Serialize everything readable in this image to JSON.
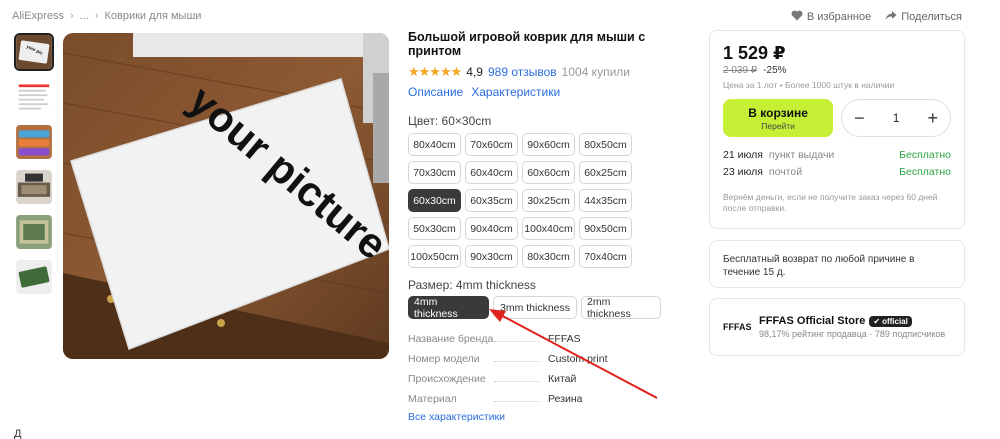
{
  "breadcrumb": {
    "root": "AliExpress",
    "ellipsis": "...",
    "category": "Коврики для мыши"
  },
  "top_actions": {
    "favorite": "В избранное",
    "share": "Поделиться"
  },
  "product": {
    "title": "Большой игровой коврик для мыши с принтом",
    "rating": "4,9",
    "reviews": "989 отзывов",
    "sold": "1004 купили",
    "link_description": "Описание",
    "link_specs": "Характеристики",
    "image_text": "your picture"
  },
  "color_option": {
    "label": "Цвет: 60×30cm",
    "sizes": [
      "80x40cm",
      "70x60cm",
      "90x60cm",
      "80x50cm",
      "70x30cm",
      "60x40cm",
      "60x60cm",
      "60x25cm",
      "60x30cm",
      "60x35cm",
      "30x25cm",
      "44x35cm",
      "50x30cm",
      "90x40cm",
      "100x40cm",
      "90x50cm",
      "100x50cm",
      "90x30cm",
      "80x30cm",
      "70x40cm"
    ],
    "selected": "60x30cm"
  },
  "thickness_option": {
    "label": "Размер: 4mm thickness",
    "values": [
      "4mm thickness",
      "3mm thickness",
      "2mm thickness"
    ],
    "selected": "4mm thickness"
  },
  "specs": [
    {
      "k": "Название бренда",
      "v": "FFFAS"
    },
    {
      "k": "Номер модели",
      "v": "Custom print"
    },
    {
      "k": "Происхождение",
      "v": "Китай"
    },
    {
      "k": "Материал",
      "v": "Резина"
    }
  ],
  "all_specs": "Все характеристики",
  "buy_box": {
    "price": "1 529 ₽",
    "old_price": "2 039 ₽",
    "discount": "-25%",
    "note": "Цена за 1 лот • Более 1000 штук в наличии",
    "cart_label": "В корзине",
    "cart_sub": "Перейти",
    "qty": "1",
    "qty_minus": "−",
    "qty_plus": "+",
    "delivery": [
      {
        "date": "21 июля",
        "method": "пункт выдачи",
        "price": "Бесплатно"
      },
      {
        "date": "23 июля",
        "method": "почтой",
        "price": "Бесплатно"
      }
    ],
    "refund": "Вернём деньги, если не получите заказ через 60 дней после отправки."
  },
  "return_box": {
    "text": "Бесплатный возврат по любой причине в течение 15 д."
  },
  "store": {
    "logo": "FFFAS",
    "name": "FFFAS Official Store",
    "badge": "official",
    "sub": "98,17% рейтинг продавца · 789 подписчиков"
  },
  "bottom": {
    "glyph": "Д"
  },
  "colors": {
    "accent": "#c6f036",
    "link": "#2a6de0",
    "free": "#2aa444",
    "arrow": "#e0221c",
    "star": "#f5a623"
  }
}
